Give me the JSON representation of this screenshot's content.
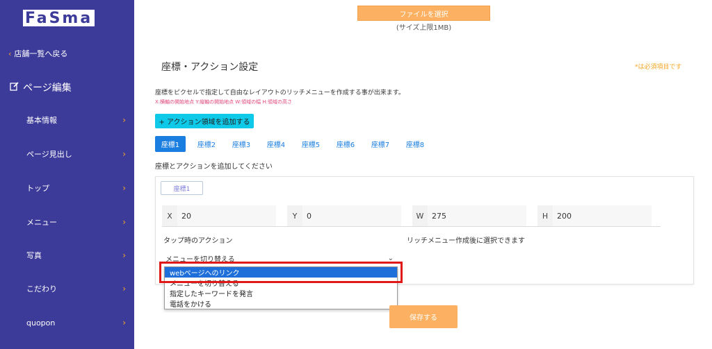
{
  "sidebar": {
    "logo": "FaSma",
    "back_label": "店舗一覧へ戻る",
    "page_edit_label": "ページ編集",
    "items": [
      {
        "label": "基本情報"
      },
      {
        "label": "ページ見出し"
      },
      {
        "label": "トップ"
      },
      {
        "label": "メニュー"
      },
      {
        "label": "写真"
      },
      {
        "label": "こだわり"
      },
      {
        "label": "quopon"
      }
    ]
  },
  "upload": {
    "button_label": "ファイルを選択",
    "size_limit": "(サイズ上限1MB)"
  },
  "section": {
    "title": "座標・アクション設定",
    "required_note": "*は必須項目です",
    "description": "座標をピクセルで指定して自由なレイアウトのリッチメニューを作成する事が出来ます。",
    "hint": "X:横軸の開始地点 Y:縦軸の開始地点 W:領域の幅 H:領域の高さ",
    "add_area_label": "+ アクション領域を追加する",
    "add_coords_prompt": "座標とアクションを追加してください"
  },
  "tabs": [
    {
      "label": "座標1",
      "active": true
    },
    {
      "label": "座標2"
    },
    {
      "label": "座標3"
    },
    {
      "label": "座標4"
    },
    {
      "label": "座標5"
    },
    {
      "label": "座標6"
    },
    {
      "label": "座標7"
    },
    {
      "label": "座標8"
    }
  ],
  "card": {
    "coord_tag": "座標1",
    "fields": [
      {
        "label": "X",
        "value": "20"
      },
      {
        "label": "Y",
        "value": "0"
      },
      {
        "label": "W",
        "value": "275"
      },
      {
        "label": "H",
        "value": "200"
      }
    ],
    "tap_action_label": "タップ時のアクション",
    "rich_menu_note": "リッチメニュー作成後に選択できます",
    "select_current": "メニューを切り替える"
  },
  "dropdown": {
    "options": [
      {
        "label": "webページへのリンク",
        "selected": true
      },
      {
        "label": "メニューを切り替える"
      },
      {
        "label": "指定したキーワードを発言"
      },
      {
        "label": "電話をかける"
      }
    ]
  },
  "save_label": "保存する",
  "colors": {
    "sidebar_bg": "#3d3b9a",
    "accent_orange": "#fbb161",
    "tab_blue": "#1a7ee0",
    "add_button_cyan": "#0ec9e8",
    "highlight_red": "#e01818"
  }
}
